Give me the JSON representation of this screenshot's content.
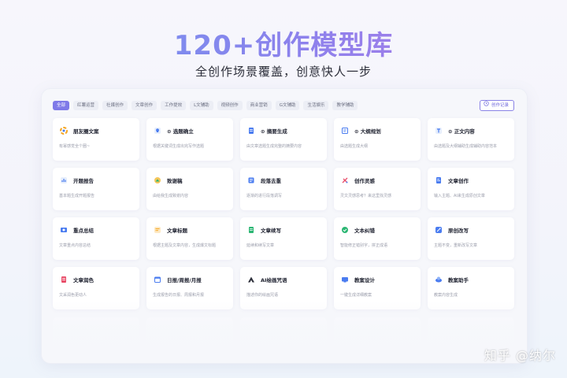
{
  "hero": {
    "title": "120+创作模型库",
    "subtitle": "全创作场景覆盖，创意快人一步"
  },
  "tabs": [
    {
      "label": "全部",
      "active": true
    },
    {
      "label": "红薯运营",
      "active": false
    },
    {
      "label": "社媒创作",
      "active": false
    },
    {
      "label": "文章创作",
      "active": false
    },
    {
      "label": "工作提效",
      "active": false
    },
    {
      "label": "L文辅助",
      "active": false
    },
    {
      "label": "视频创作",
      "active": false
    },
    {
      "label": "商业营销",
      "active": false
    },
    {
      "label": "G文辅助",
      "active": false
    },
    {
      "label": "生活娱乐",
      "active": false
    },
    {
      "label": "教学辅助",
      "active": false
    }
  ],
  "history_button": {
    "label": "创作记录",
    "icon": "clock-icon"
  },
  "cards": [
    {
      "title": "朋友圈文案",
      "desc": "有幂感觉全个圈~",
      "icon": "wheel-icon",
      "color": "#f5a623"
    },
    {
      "title": "⊙ 选题确立",
      "desc": "根据关键词生成出完写作选题",
      "icon": "lightbulb-icon",
      "color": "#4a7cf0"
    },
    {
      "title": "⊙ 摘要生成",
      "desc": "由文章选题生成完整的摘要内容",
      "icon": "document-icon",
      "color": "#4a7cf0"
    },
    {
      "title": "⊙ 大纲规划",
      "desc": "由选题生成大纲",
      "icon": "outline-icon",
      "color": "#4a7cf0"
    },
    {
      "title": "⊙ 正文内容",
      "desc": "由选题及大纲辅助生成辅助内容范本",
      "icon": "text-icon",
      "color": "#4a7cf0"
    },
    {
      "title": "开题报告",
      "desc": "基本题生成开题报告",
      "icon": "report-icon",
      "color": "#4a7cf0"
    },
    {
      "title": "致谢稿",
      "desc": "由给我生成致谢内容",
      "icon": "thanks-icon",
      "color": "#2bb673"
    },
    {
      "title": "段落去重",
      "desc": "逐渐的进行段落调写",
      "icon": "paragraph-icon",
      "color": "#4a7cf0"
    },
    {
      "title": "创作灵感",
      "desc": "灵文灵感思考？来这里找灵感",
      "icon": "sparkle-icon",
      "color": "#e94e6a"
    },
    {
      "title": "文章创作",
      "desc": "输入主题、AI来生成原创文章",
      "icon": "article-icon",
      "color": "#4a7cf0"
    },
    {
      "title": "重点总结",
      "desc": "文章重点内容总结",
      "icon": "summary-icon",
      "color": "#4a7cf0"
    },
    {
      "title": "文章标题",
      "desc": "根据主题及文章内容，生成爆文标题",
      "icon": "headline-icon",
      "color": "#f5a623"
    },
    {
      "title": "文章续写",
      "desc": "延续和续写文章",
      "icon": "continue-icon",
      "color": "#2bb673"
    },
    {
      "title": "文本纠错",
      "desc": "智能修正错别字，拼正成语",
      "icon": "proofread-icon",
      "color": "#2bb673"
    },
    {
      "title": "原创改写",
      "desc": "主题不变，重新改写文章",
      "icon": "rewrite-icon",
      "color": "#4a7cf0"
    },
    {
      "title": "文章润色",
      "desc": "文采润色更动人",
      "icon": "polish-icon",
      "color": "#e94e6a"
    },
    {
      "title": "日报/周报/月报",
      "desc": "生成报告的日报、周报和月报",
      "icon": "calendar-icon",
      "color": "#4a7cf0"
    },
    {
      "title": "AI绘画咒语",
      "desc": "描述你的绘画咒语",
      "icon": "paint-icon",
      "color": "#2d2f3a"
    },
    {
      "title": "教案设计",
      "desc": "一键生成详细教案",
      "icon": "lesson-icon",
      "color": "#4a7cf0"
    },
    {
      "title": "教案助手",
      "desc": "教案内容生成",
      "icon": "assistant-icon",
      "color": "#4a7cf0"
    }
  ],
  "watermark": "知乎 @纳尔"
}
